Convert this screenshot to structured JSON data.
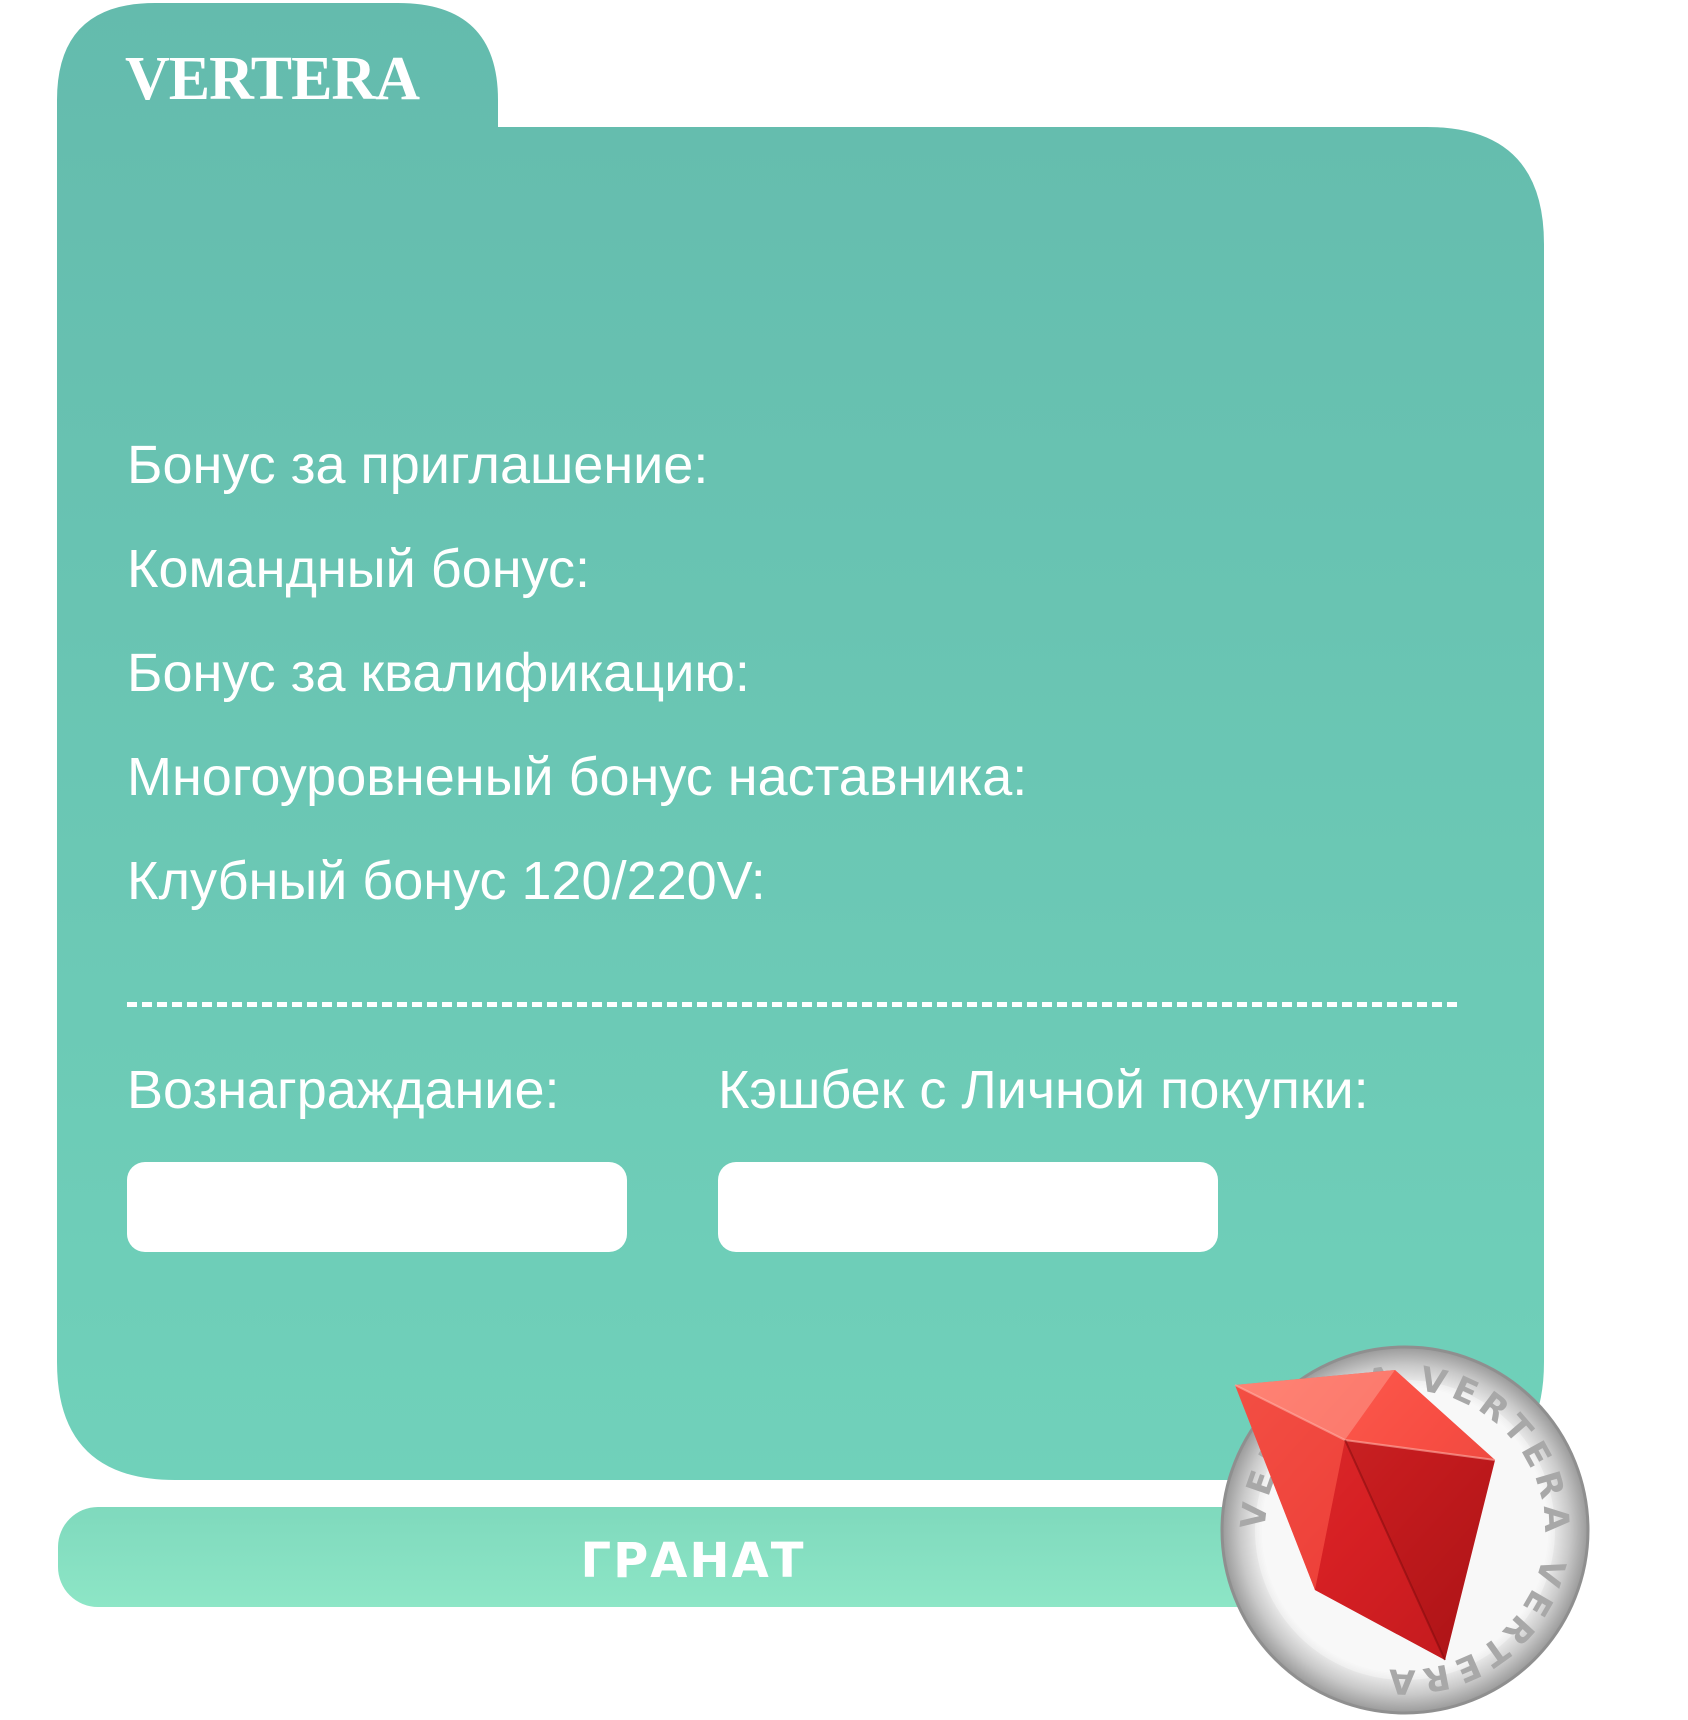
{
  "card": {
    "brand": "VERTERA",
    "bonuses": [
      "Бонус за приглашение:",
      "Командный бонус:",
      "Бонус за квалификацию:",
      "Многоуровненый бонус наставника:",
      "Клубный бонус 120/220V:"
    ],
    "reward_label": "Вознаграждание:",
    "cashback_label": "Кэшбек с Личной покупки:",
    "reward_value": "",
    "cashback_value": ""
  },
  "rank": {
    "label": "ГРАНАТ"
  },
  "badge": {
    "ring_text": "VERTERA VERTERA VERTERA",
    "icon": "garnet-gem-icon"
  },
  "colors": {
    "card_top": "#64bbad",
    "card_bottom": "#70d1ba",
    "rank_bar": "#86dfc2",
    "gem_red": "#e4292c",
    "ring_silver": "#c8c8c8"
  }
}
